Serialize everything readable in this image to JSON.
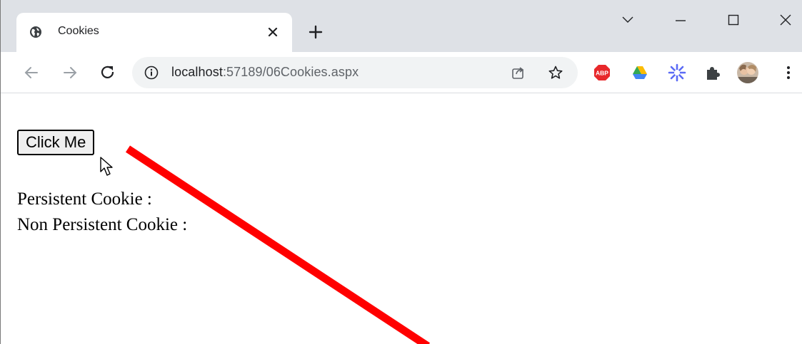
{
  "browser": {
    "tab": {
      "title": "Cookies",
      "favicon": "globe-icon"
    },
    "address": {
      "host": "localhost",
      "path": ":57189/06Cookies.aspx"
    },
    "extensions": [
      "adblock-plus-icon",
      "google-drive-icon",
      "snowflake-extension-icon",
      "puzzle-extensions-icon",
      "profile-avatar"
    ],
    "window_controls": [
      "chevron-down-icon",
      "minimize-icon",
      "maximize-icon",
      "close-window-icon"
    ]
  },
  "page": {
    "button_label": "Click Me",
    "persistent_label": "Persistent Cookie :",
    "persistent_value": "",
    "non_persistent_label": "Non Persistent Cookie :",
    "non_persistent_value": ""
  },
  "colors": {
    "tabstrip": "#dee1e6",
    "omnibox": "#f1f3f4",
    "annotation_line": "#ff0000",
    "abp_red": "#e8282b"
  }
}
